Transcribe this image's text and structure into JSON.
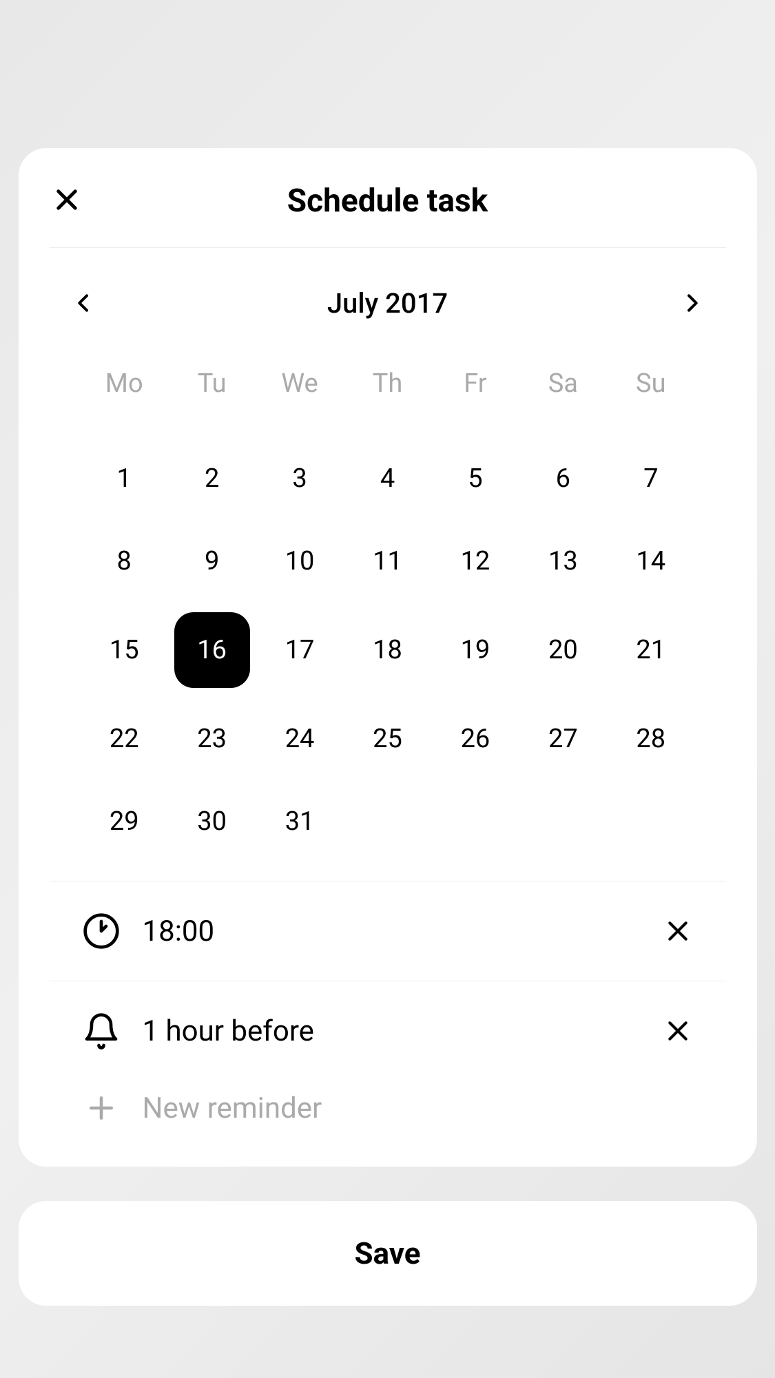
{
  "header": {
    "title": "Schedule task"
  },
  "calendar": {
    "month_label": "July 2017",
    "weekdays": [
      "Mo",
      "Tu",
      "We",
      "Th",
      "Fr",
      "Sa",
      "Su"
    ],
    "days": [
      1,
      2,
      3,
      4,
      5,
      6,
      7,
      8,
      9,
      10,
      11,
      12,
      13,
      14,
      15,
      16,
      17,
      18,
      19,
      20,
      21,
      22,
      23,
      24,
      25,
      26,
      27,
      28,
      29,
      30,
      31
    ],
    "selected_day": 16
  },
  "time": {
    "value": "18:00"
  },
  "reminders": [
    {
      "label": "1 hour before"
    }
  ],
  "new_reminder_label": "New reminder",
  "save_label": "Save"
}
